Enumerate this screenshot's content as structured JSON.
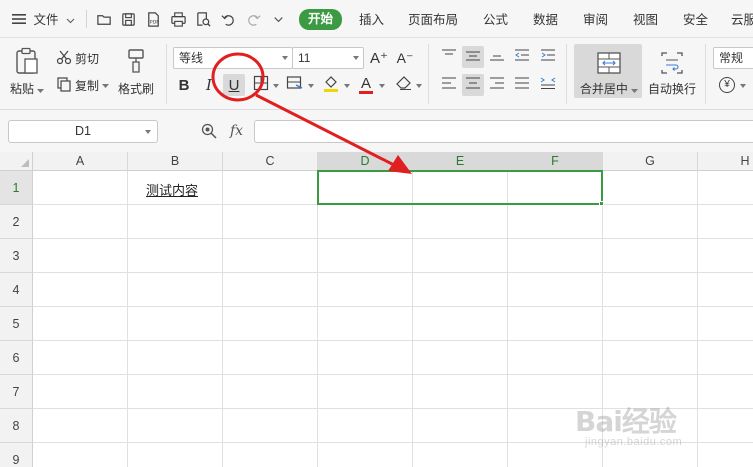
{
  "menubar": {
    "file_label": "文件",
    "tabs": [
      {
        "label": "开始",
        "active": true
      },
      {
        "label": "插入"
      },
      {
        "label": "页面布局"
      },
      {
        "label": "公式"
      },
      {
        "label": "数据"
      },
      {
        "label": "审阅"
      },
      {
        "label": "视图"
      },
      {
        "label": "安全"
      },
      {
        "label": "云服"
      }
    ],
    "quick_access_icons": [
      "open-folder-icon",
      "save-icon",
      "export-pdf-icon",
      "print-icon",
      "print-preview-icon",
      "undo-icon",
      "redo-icon",
      "more-icon"
    ]
  },
  "ribbon": {
    "paste_label": "粘贴",
    "cut_label": "剪切",
    "copy_label": "复制",
    "format_painter_label": "格式刷",
    "font_name": "等线",
    "font_size": "11",
    "merge_center_label": "合并居中",
    "wrap_text_label": "自动换行",
    "number_format": "常规",
    "bold_glyph": "B",
    "italic_glyph": "I",
    "underline_glyph": "U",
    "grow_font_glyph": "A⁺",
    "shrink_font_glyph": "A⁻",
    "font_color_glyph": "A",
    "currency_glyph": "¥"
  },
  "formula_bar": {
    "name_box": "D1",
    "fx_label": "fx",
    "formula_value": ""
  },
  "grid": {
    "columns": [
      "A",
      "B",
      "C",
      "D",
      "E",
      "F",
      "G",
      "H"
    ],
    "rows": [
      "1",
      "2",
      "3",
      "4",
      "5",
      "6",
      "7",
      "8",
      "9"
    ],
    "selected_columns": [
      "D",
      "E",
      "F"
    ],
    "selected_row": "1",
    "cell_b1": "测试内容"
  },
  "colors": {
    "accent": "#3c9a43",
    "annotation": "#e02020"
  },
  "watermark": {
    "brand": "Bai经验",
    "sub": "jingyan.baidu.com"
  }
}
